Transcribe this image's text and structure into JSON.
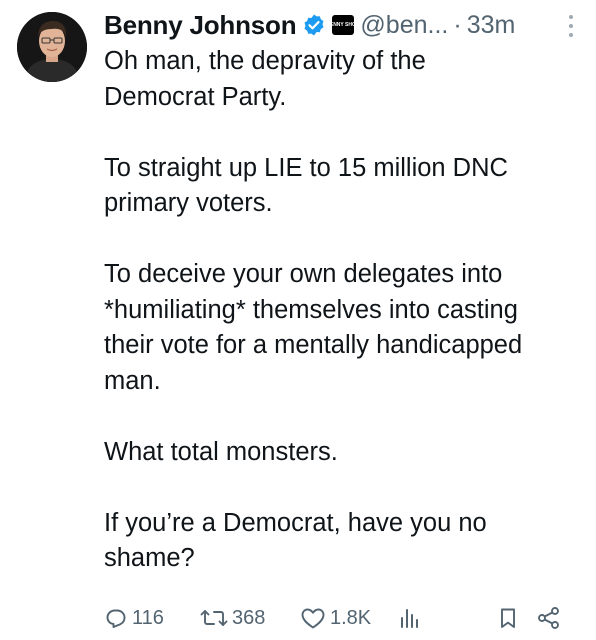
{
  "author": {
    "display_name": "Benny Johnson",
    "handle": "@ben...",
    "separator": "·",
    "timestamp": "33m",
    "avatar_icon": "profile-photo",
    "verified_icon": "verified-badge-icon",
    "verified_color": "#1d9bf0",
    "affiliation_badge_text": "BENNY SHOW"
  },
  "tweet": {
    "paragraphs": [
      [
        "Oh man, the depravity of the",
        "Democrat Party."
      ],
      [
        "To straight up LIE to 15 million DNC",
        "primary voters."
      ],
      [
        "To deceive your own delegates into",
        "*humiliating* themselves into casting",
        "their vote for a mentally handicapped",
        "man."
      ],
      [
        "What total monsters."
      ],
      [
        "If you’re a Democrat, have you no",
        "shame?"
      ]
    ]
  },
  "actions": {
    "reply_count": "116",
    "retweet_count": "368",
    "like_count": "1.8K",
    "icon_color": "#536471"
  }
}
